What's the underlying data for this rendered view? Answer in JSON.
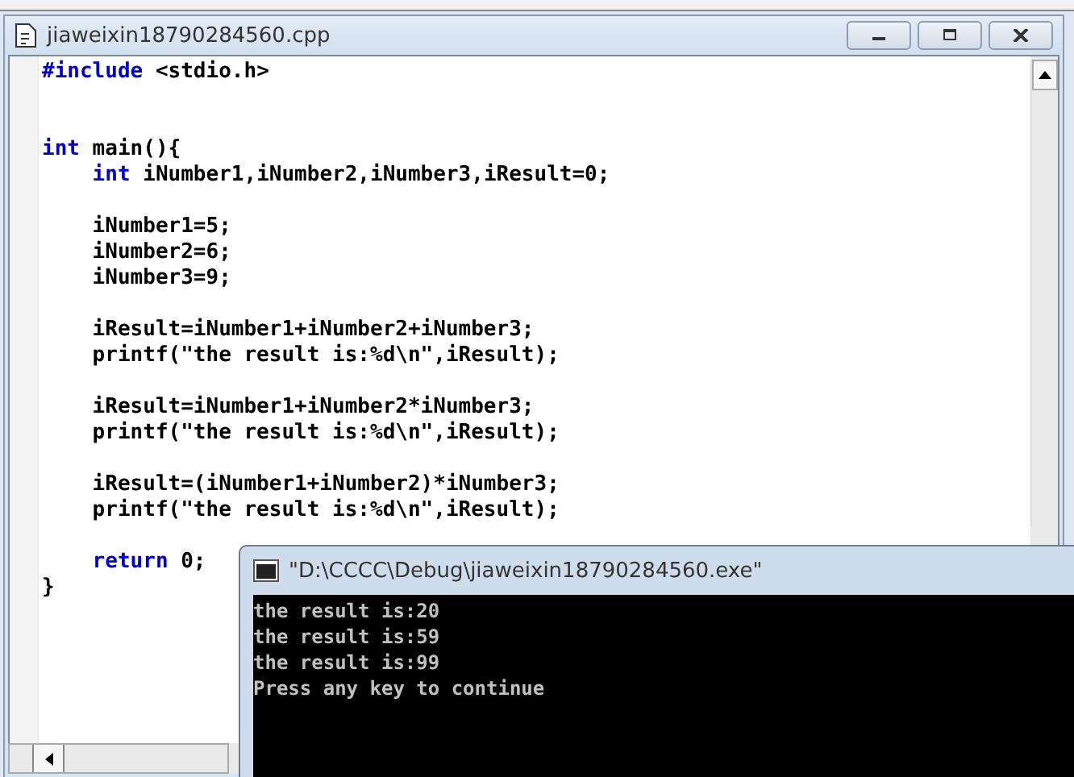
{
  "editor": {
    "title": "jiaweixin18790284560.cpp",
    "lines": [
      {
        "kind": "code",
        "tokens": [
          {
            "text": "#include",
            "kind": "keyword"
          },
          {
            "text": " <stdio.h>",
            "kind": "plain"
          }
        ]
      },
      {
        "kind": "blank"
      },
      {
        "kind": "blank"
      },
      {
        "kind": "code",
        "tokens": [
          {
            "text": "int",
            "kind": "keyword"
          },
          {
            "text": " main(){",
            "kind": "plain"
          }
        ]
      },
      {
        "kind": "code",
        "tokens": [
          {
            "text": "    int",
            "kind": "keyword"
          },
          {
            "text": " iNumber1,iNumber2,iNumber3,iResult=0;",
            "kind": "plain"
          }
        ]
      },
      {
        "kind": "blank"
      },
      {
        "kind": "code",
        "tokens": [
          {
            "text": "    iNumber1=5;",
            "kind": "plain"
          }
        ]
      },
      {
        "kind": "code",
        "tokens": [
          {
            "text": "    iNumber2=6;",
            "kind": "plain"
          }
        ]
      },
      {
        "kind": "code",
        "tokens": [
          {
            "text": "    iNumber3=9;",
            "kind": "plain"
          }
        ]
      },
      {
        "kind": "blank"
      },
      {
        "kind": "code",
        "tokens": [
          {
            "text": "    iResult=iNumber1+iNumber2+iNumber3;",
            "kind": "plain"
          }
        ]
      },
      {
        "kind": "code",
        "tokens": [
          {
            "text": "    printf(\"the result is:%d\\n\",iResult);",
            "kind": "plain"
          }
        ]
      },
      {
        "kind": "blank"
      },
      {
        "kind": "code",
        "tokens": [
          {
            "text": "    iResult=iNumber1+iNumber2*iNumber3;",
            "kind": "plain"
          }
        ]
      },
      {
        "kind": "code",
        "tokens": [
          {
            "text": "    printf(\"the result is:%d\\n\",iResult);",
            "kind": "plain"
          }
        ]
      },
      {
        "kind": "blank"
      },
      {
        "kind": "code",
        "tokens": [
          {
            "text": "    iResult=(iNumber1+iNumber2)*iNumber3;",
            "kind": "plain"
          }
        ]
      },
      {
        "kind": "code",
        "tokens": [
          {
            "text": "    printf(\"the result is:%d\\n\",iResult);",
            "kind": "plain"
          }
        ]
      },
      {
        "kind": "blank"
      },
      {
        "kind": "code",
        "tokens": [
          {
            "text": "    return",
            "kind": "keyword"
          },
          {
            "text": " 0;",
            "kind": "plain"
          }
        ]
      },
      {
        "kind": "code",
        "tokens": [
          {
            "text": "}",
            "kind": "plain"
          }
        ]
      }
    ]
  },
  "console": {
    "title": "\"D:\\CCCC\\Debug\\jiaweixin18790284560.exe\"",
    "lines": [
      "the result is:20",
      "the result is:59",
      "the result is:99",
      "Press any key to continue"
    ]
  }
}
